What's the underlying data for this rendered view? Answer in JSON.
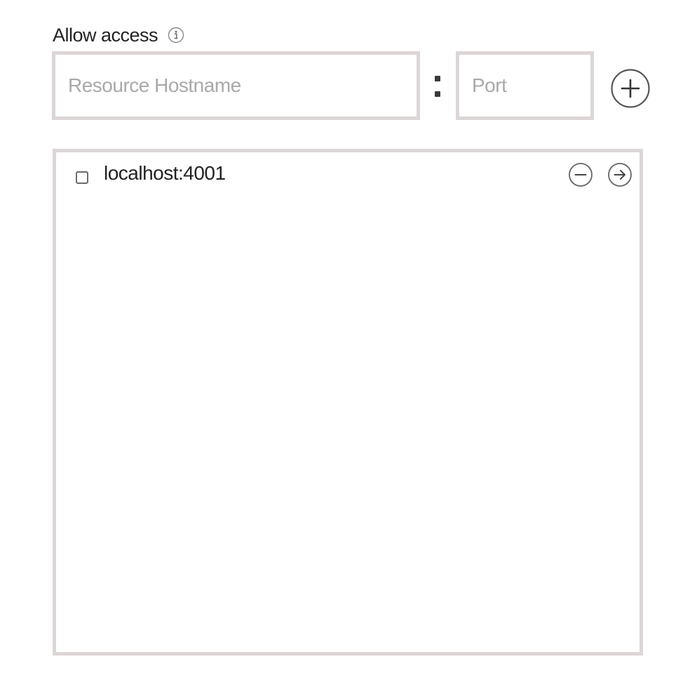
{
  "header": {
    "label": "Allow access",
    "info_icon": "info-icon"
  },
  "form": {
    "host_placeholder": "Resource Hostname",
    "host_value": "",
    "separator": ":",
    "port_placeholder": "Port",
    "port_value": "",
    "add_icon": "plus-circle-icon"
  },
  "access_list": {
    "items": [
      {
        "label": "localhost:4001",
        "checked": false,
        "remove_icon": "minus-circle-icon",
        "open_icon": "arrow-right-circle-icon"
      }
    ]
  },
  "colors": {
    "border": "#ddd6d6",
    "text": "#222222",
    "placeholder": "#a9a9a9",
    "icon": "#555555"
  }
}
